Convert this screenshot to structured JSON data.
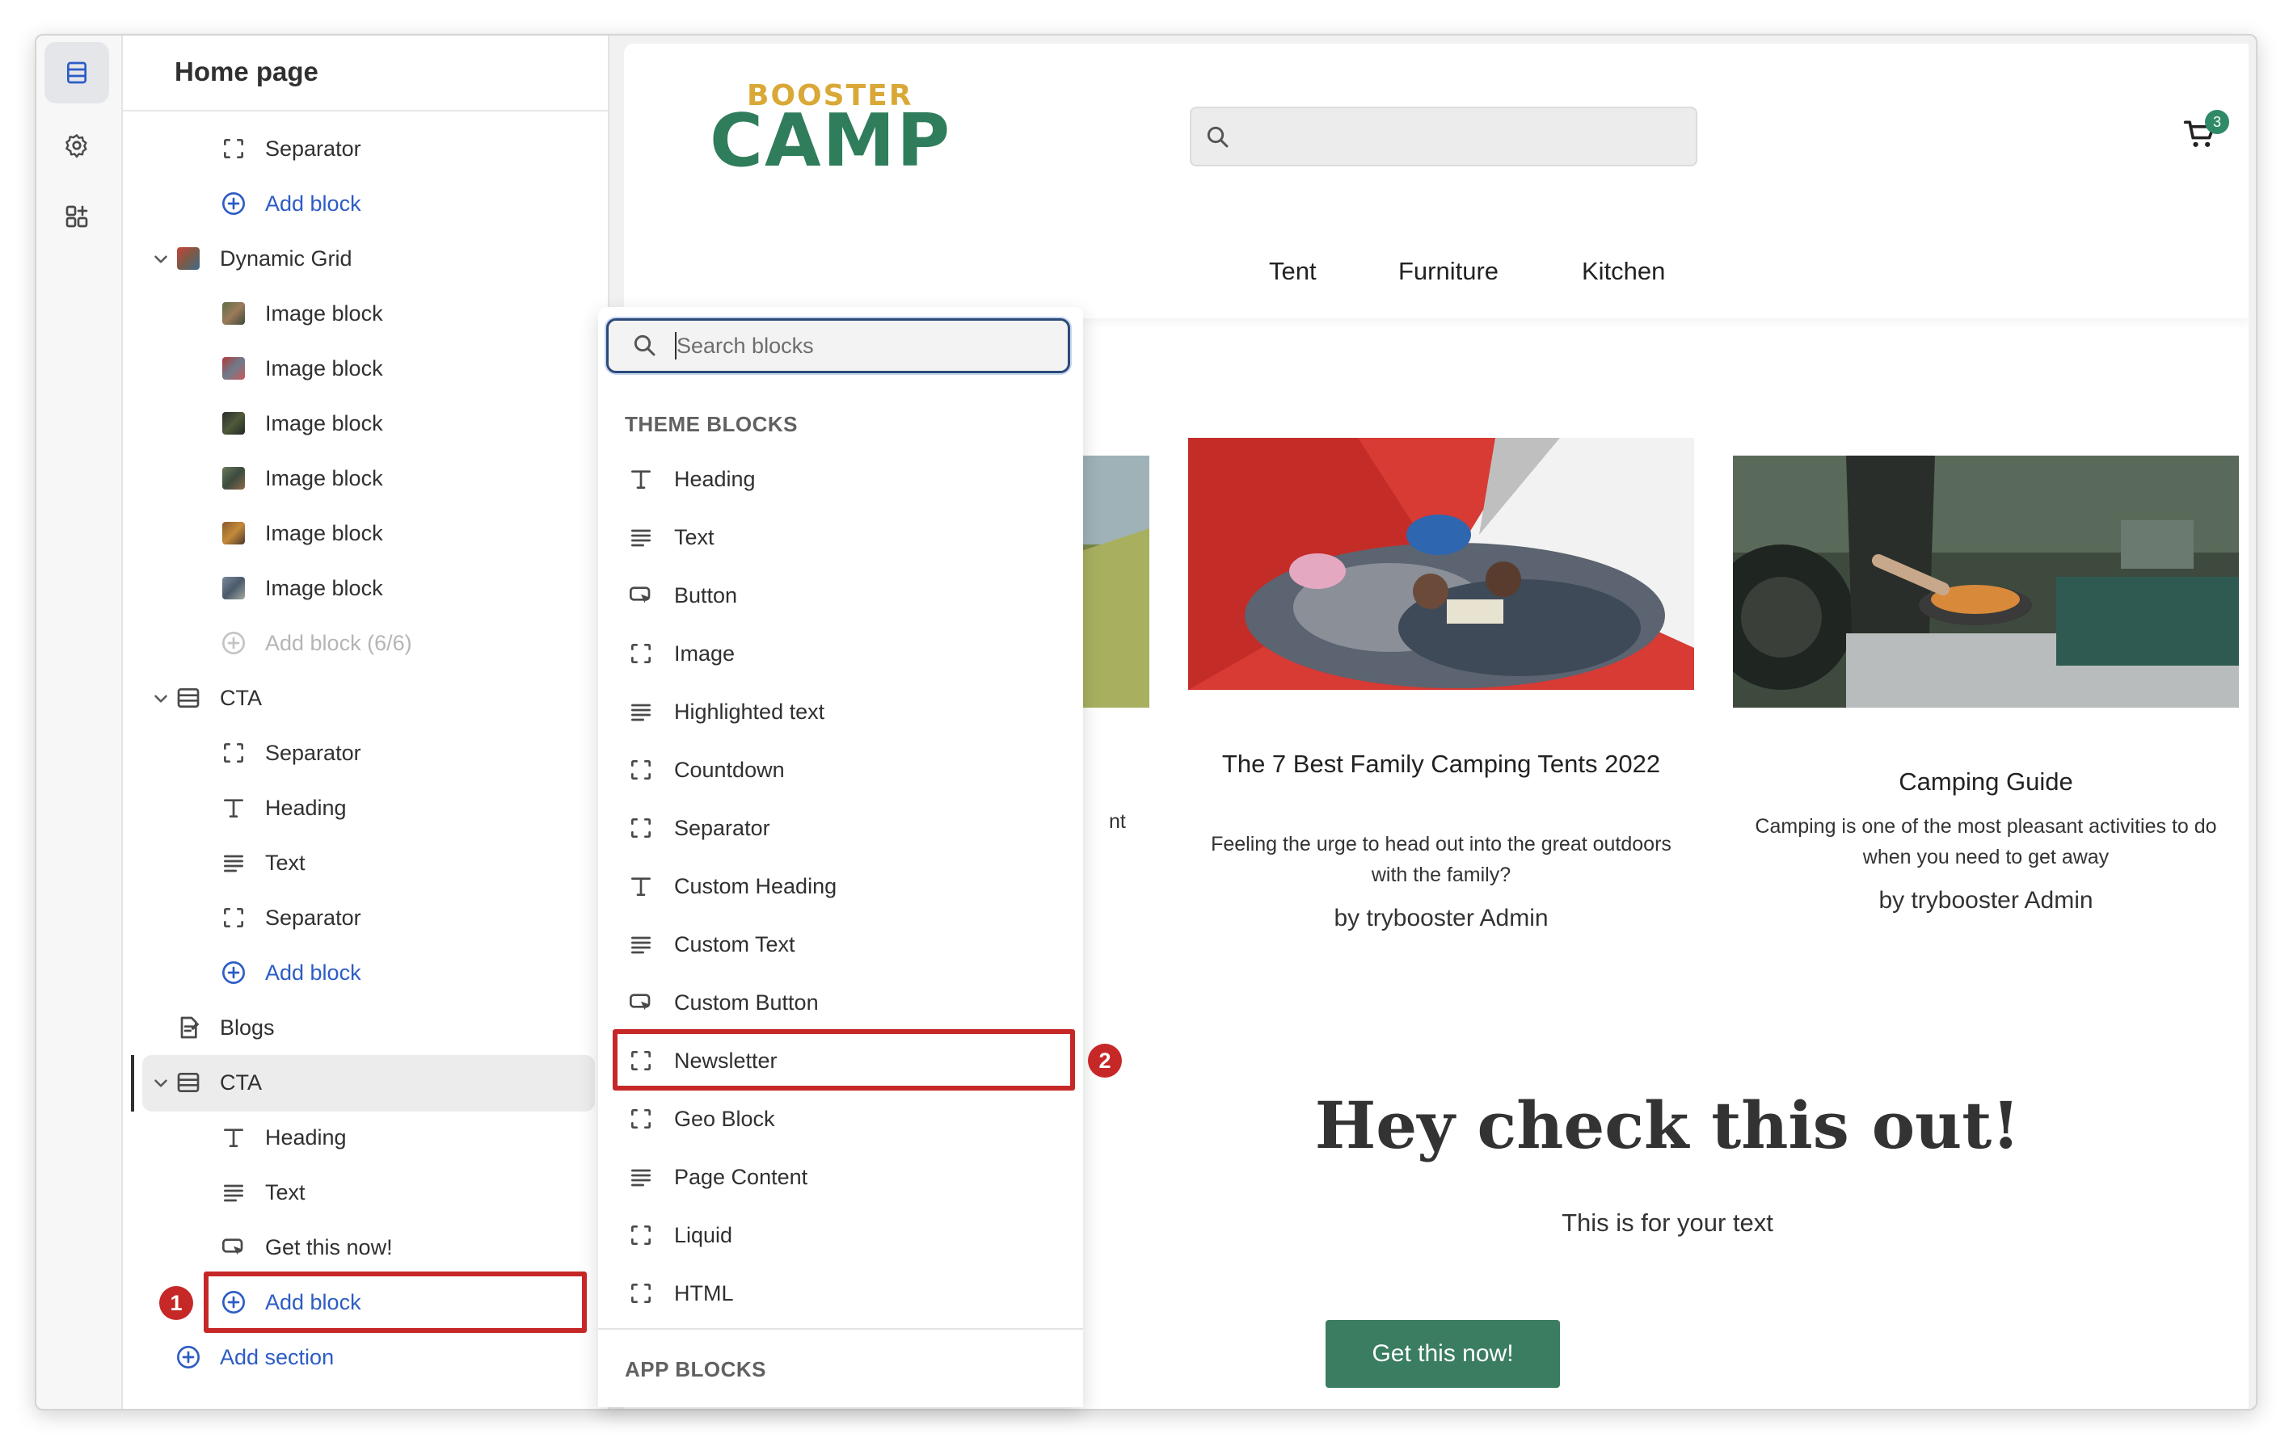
{
  "sidebar": {
    "title": "Home page",
    "rows": [
      {
        "label": "Separator"
      },
      {
        "label": "Add block"
      },
      {
        "label": "Dynamic Grid"
      },
      {
        "label": "Image block"
      },
      {
        "label": "Image block"
      },
      {
        "label": "Image block"
      },
      {
        "label": "Image block"
      },
      {
        "label": "Image block"
      },
      {
        "label": "Image block"
      },
      {
        "label": "Add block (6/6)"
      },
      {
        "label": "CTA"
      },
      {
        "label": "Separator"
      },
      {
        "label": "Heading"
      },
      {
        "label": "Text"
      },
      {
        "label": "Separator"
      },
      {
        "label": "Add block"
      },
      {
        "label": "Blogs"
      },
      {
        "label": "CTA"
      },
      {
        "label": "Heading"
      },
      {
        "label": "Text"
      },
      {
        "label": "Get this now!"
      },
      {
        "label": "Add block"
      },
      {
        "label": "Add section"
      }
    ]
  },
  "store": {
    "logo_top": "BOOSTER",
    "logo_main": "CAMP",
    "cart_count": "3",
    "nav": [
      "Tent",
      "Furniture",
      "Kitchen"
    ],
    "cards": [
      {
        "title": "",
        "desc": "nt",
        "by": ""
      },
      {
        "title": "The 7 Best Family Camping Tents 2022",
        "desc": "Feeling the urge to head out into the great outdoors with the family?",
        "by": "by trybooster Admin"
      },
      {
        "title": "Camping Guide",
        "desc": "Camping is one of the most pleasant activities to do when you need to get away",
        "by": "by trybooster Admin"
      }
    ],
    "hero": {
      "heading": "Hey check this out!",
      "text": "This is for your text",
      "button": "Get this now!"
    }
  },
  "picker": {
    "search_placeholder": "Search blocks",
    "theme_header": "THEME BLOCKS",
    "items": [
      {
        "label": "Heading",
        "icon": "heading-icon"
      },
      {
        "label": "Text",
        "icon": "text-icon"
      },
      {
        "label": "Button",
        "icon": "button-icon"
      },
      {
        "label": "Image",
        "icon": "block-icon"
      },
      {
        "label": "Highlighted text",
        "icon": "text-icon"
      },
      {
        "label": "Countdown",
        "icon": "block-icon"
      },
      {
        "label": "Separator",
        "icon": "block-icon"
      },
      {
        "label": "Custom Heading",
        "icon": "heading-icon"
      },
      {
        "label": "Custom Text",
        "icon": "text-icon"
      },
      {
        "label": "Custom Button",
        "icon": "button-icon"
      },
      {
        "label": "Newsletter",
        "icon": "block-icon"
      },
      {
        "label": "Geo Block",
        "icon": "block-icon"
      },
      {
        "label": "Page Content",
        "icon": "text-icon"
      },
      {
        "label": "Liquid",
        "icon": "block-icon"
      },
      {
        "label": "HTML",
        "icon": "block-icon"
      }
    ],
    "app_header": "APP BLOCKS"
  },
  "annotations": {
    "step1": "1",
    "step2": "2"
  },
  "colors": {
    "link_blue": "#2c5cc5",
    "highlight_red": "#c62828",
    "brand_green": "#2f7d5b",
    "brand_gold": "#d9a837",
    "button_green": "#3a7d61"
  }
}
